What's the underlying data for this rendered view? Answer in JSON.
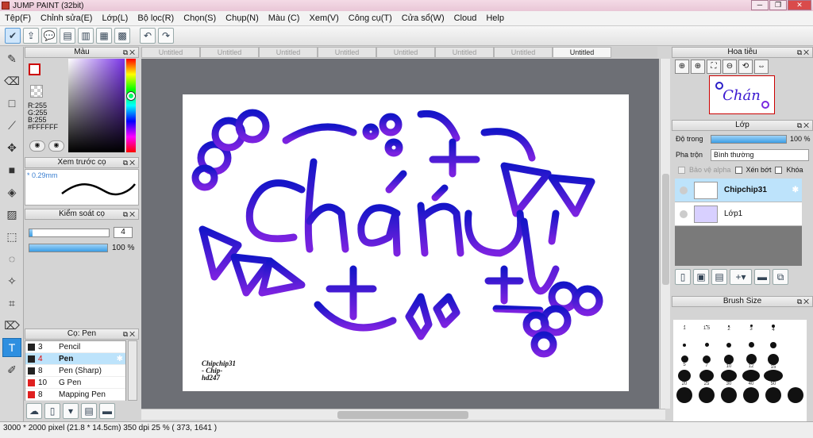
{
  "window": {
    "title": "JUMP PAINT (32bit)",
    "buttons": [
      "─",
      "❐",
      "✕"
    ]
  },
  "menu": [
    "Tệp(F)",
    "Chỉnh sửa(E)",
    "Lớp(L)",
    "Bộ lọc(R)",
    "Chọn(S)",
    "Chụp(N)",
    "Màu (C)",
    "Xem(V)",
    "Công cụ(T)",
    "Cửa sổ(W)",
    "Cloud",
    "Help"
  ],
  "color_panel": {
    "title": "Màu",
    "r": "R:255",
    "g": "G:255",
    "b": "B:255",
    "hex": "#FFFFFF"
  },
  "brush_preview": {
    "title": "Xem trước cọ",
    "size": "* 0.29mm"
  },
  "brush_control": {
    "title": "Kiểm soát cọ",
    "size_value": "4",
    "opacity_value": "100 %"
  },
  "brush_list": {
    "title": "Cọ: Pen",
    "items": [
      {
        "num": "3",
        "name": "Pencil",
        "red": false,
        "selected": false
      },
      {
        "num": "4",
        "name": "Pen",
        "red": false,
        "selected": true
      },
      {
        "num": "8",
        "name": "Pen (Sharp)",
        "red": false,
        "selected": false
      },
      {
        "num": "10",
        "name": "G Pen",
        "red": true,
        "selected": false
      },
      {
        "num": "8",
        "name": "Mapping Pen",
        "red": true,
        "selected": false
      }
    ]
  },
  "tabs": [
    "Untitled",
    "Untitled",
    "Untitled",
    "Untitled",
    "Untitled",
    "Untitled",
    "Untitled",
    "Untitled"
  ],
  "artwork": {
    "text": "Chán",
    "signature_line1": "Chipchip31",
    "signature_line2": "- Chip-",
    "signature_line3": "hd247",
    "colors": {
      "top": "#1515c8",
      "bottom": "#7b22e0"
    }
  },
  "navigator": {
    "title": "Hoa tiêu",
    "thumb_text": "Chán"
  },
  "layers": {
    "title": "Lớp",
    "opacity_label": "Độ trong",
    "opacity_value": "100 %",
    "blend_label": "Pha trộn",
    "blend_value": "Bình thường",
    "protect_alpha": "Bảo vệ alpha",
    "clip": "Xén bớt",
    "lock": "Khóa",
    "items": [
      {
        "name": "Chipchip31",
        "selected": true
      },
      {
        "name": "Lớp1",
        "selected": false
      }
    ]
  },
  "brush_size": {
    "title": "Brush Size",
    "sizes": [
      "1",
      "1.5",
      "2",
      "3",
      "4",
      "",
      "",
      "",
      "",
      "",
      "",
      "",
      "5",
      "7",
      "10",
      "12",
      "15",
      "",
      "20",
      "25",
      "30",
      "40",
      "50",
      "",
      "",
      "",
      "",
      "",
      "",
      ""
    ]
  },
  "status": "3000 * 2000 pixel  (21.8 * 14.5cm)  350 dpi  25 %  ( 373, 1641 )"
}
